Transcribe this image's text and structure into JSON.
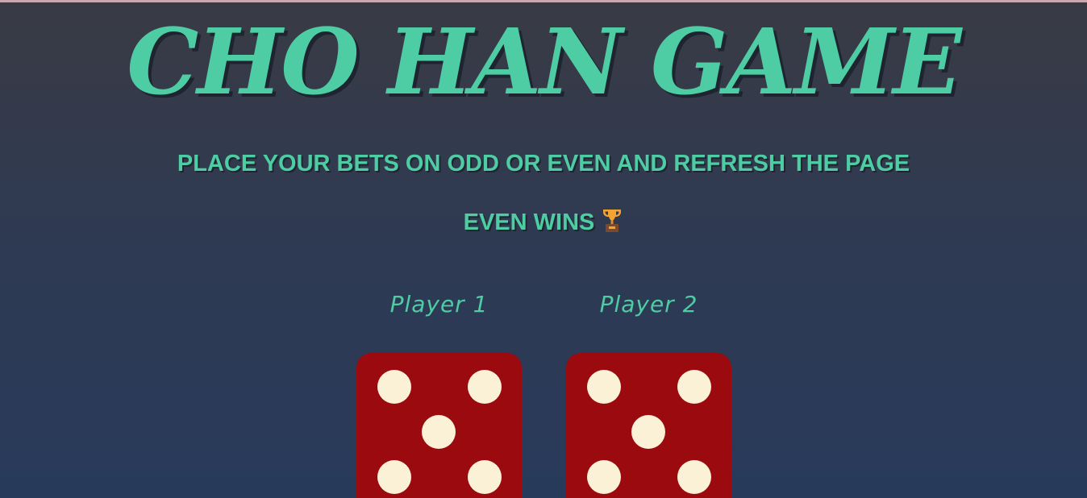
{
  "game": {
    "title": "CHO HAN GAME",
    "instruction": "PLACE YOUR BETS ON ODD OR EVEN AND REFRESH THE PAGE",
    "result_text": "EVEN WINS",
    "result_icon": "trophy-icon"
  },
  "players": [
    {
      "label": "Player 1",
      "die_value": 5
    },
    {
      "label": "Player 2",
      "die_value": 5
    }
  ],
  "colors": {
    "accent": "#4ecca3",
    "die_face": "#9a0a0e",
    "pip": "#fbf1d6",
    "background_top": "#393b44",
    "background_bottom": "#283a5b"
  }
}
